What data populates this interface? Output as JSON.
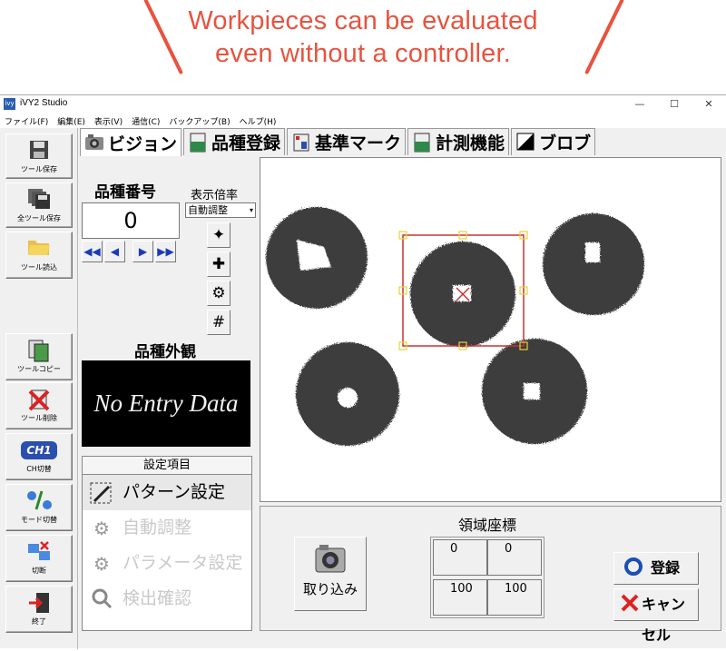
{
  "banner": {
    "line1": "Workpieces can be evaluated",
    "line2": "even without a controller."
  },
  "window": {
    "title": "iVY2 Studio",
    "controls": [
      "—",
      "☐",
      "✕"
    ]
  },
  "menu": [
    "ファイル(F)",
    "編集(E)",
    "表示(V)",
    "通信(C)",
    "バックアップ(B)",
    "ヘルプ(H)"
  ],
  "toolbar": {
    "save_tool": "ツール保存",
    "save_all": "全ツール保存",
    "load_tool": "ツール読込",
    "copy_tool": "ツールコピー",
    "delete_tool": "ツール削除",
    "ch_switch": "CH切替",
    "mode_switch": "モード切替",
    "disconnect": "切断",
    "exit": "終了",
    "ch_badge": "CH1"
  },
  "tabs": [
    "ビジョン",
    "品種登録",
    "基準マーク",
    "計測機能",
    "ブロブ"
  ],
  "product": {
    "number_label": "品種番号",
    "number_value": "0",
    "zoom_label": "表示倍率",
    "zoom_value": "自動調整",
    "appearance_label": "品種外観",
    "no_entry": "No Entry Data"
  },
  "settings": {
    "header": "設定項目",
    "items": [
      "パターン設定",
      "自動調整",
      "パラメータ設定",
      "検出確認"
    ]
  },
  "capture": {
    "label": "取り込み"
  },
  "region": {
    "label": "領域座標",
    "values": [
      "0",
      "0",
      "100",
      "100"
    ]
  },
  "actions": {
    "register": "登録",
    "cancel": "キャンセル"
  },
  "colors": {
    "accent": "#e8533f",
    "selection": "#c83232",
    "handle": "#e8d23a"
  }
}
